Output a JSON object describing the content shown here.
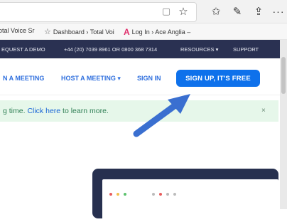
{
  "browser": {
    "icons": [
      "tab-view-icon",
      "favorite-star-icon",
      "favorites-icon",
      "pen-icon",
      "share-icon",
      "more-icon"
    ]
  },
  "bookmarks": [
    {
      "label": "otal Voice Sr"
    },
    {
      "label": "Dashboard › Total Voi"
    },
    {
      "label": "Log In › Ace Anglia –"
    }
  ],
  "topbar": {
    "request_demo": "EQUEST A DEMO",
    "phone": "+44 (20) 7039 8961 OR 0800 368 7314",
    "resources": "RESOURCES ▾",
    "support": "SUPPORT"
  },
  "nav": {
    "join": "N A MEETING",
    "host": "HOST A MEETING ▾",
    "signin": "SIGN IN",
    "signup": "SIGN UP, IT'S FREE"
  },
  "notice": {
    "before": "g time. ",
    "link": "Click here",
    "after": " to learn more.",
    "close": "×"
  },
  "colors": {
    "brand_blue": "#0e71eb",
    "topbar_navy": "#2a3152",
    "notice_green": "#e6f7ea",
    "arrow_blue": "#3a6fd0"
  }
}
